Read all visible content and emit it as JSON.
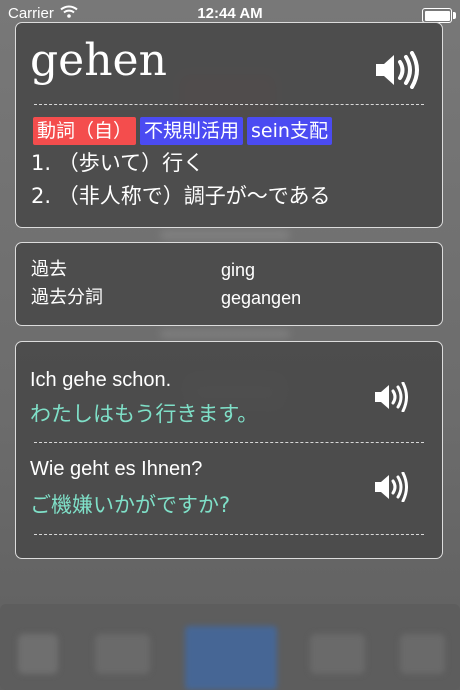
{
  "status_bar": {
    "carrier": "Carrier",
    "time": "12:44 AM",
    "battery_level": 1.0
  },
  "entry": {
    "headword": "gehen",
    "tags": [
      {
        "label": "動詞（自）",
        "color": "#f44d4d"
      },
      {
        "label": "不規則活用",
        "color": "#4b4bf2"
      },
      {
        "label": "sein支配",
        "color": "#4b4bf2"
      }
    ],
    "meanings": [
      "1. （歩いて）行く",
      "2. （非人称で）調子が～である"
    ]
  },
  "conjugation": [
    {
      "label": "過去",
      "value": "ging"
    },
    {
      "label": "過去分詞",
      "value": "gegangen"
    }
  ],
  "examples": [
    {
      "german": "Ich gehe schon.",
      "japanese": "わたしはもう行きます。"
    },
    {
      "german": "Wie geht es Ihnen?",
      "japanese": "ご機嫌いかがですか?"
    }
  ],
  "colors": {
    "accent_red": "#f44d4d",
    "accent_blue": "#4b4bf2",
    "translation": "#7fe0c8"
  },
  "icons": [
    "wifi-icon",
    "battery-icon",
    "speaker-icon"
  ]
}
